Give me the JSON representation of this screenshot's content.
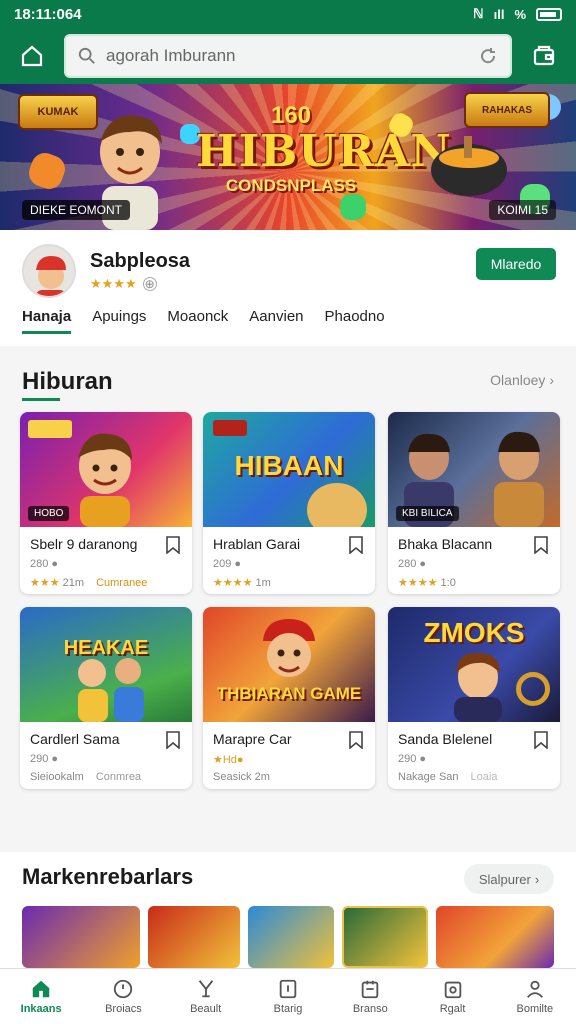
{
  "status_bar": {
    "time": "18:11:064",
    "signal": "ıll",
    "network": "%"
  },
  "search": {
    "value": "agorah Imburann"
  },
  "banner": {
    "number": "160",
    "title": "HIBURAN",
    "subtitle": "CONDSNPLASS",
    "logo_left": "KUMAK",
    "logo_right": "RAHAKAS",
    "caption_left": "DIEKE EOMONT",
    "caption_right": "KOIMI 15"
  },
  "profile": {
    "name": "Sabpleosa",
    "stars": "★★★★",
    "follow_label": "Mlaredo",
    "tabs": [
      "Hanaja",
      "Apuings",
      "Moaonck",
      "Aanvien",
      "Phaodno"
    ]
  },
  "section1": {
    "title": "Hiburan",
    "link": "Olanloey",
    "cards": [
      {
        "name": "Sbelr 9 daranong",
        "meta1": "280 ●",
        "stars": "★★★",
        "meta2": "21m",
        "right": "Cumranee",
        "tag": "HOBO",
        "thumb_label": ""
      },
      {
        "name": "Hrablan Garai",
        "meta1": "209 ●",
        "stars": "★★★★",
        "meta2": "1m",
        "right": "",
        "tag": "",
        "thumb_label": "HIBAAN"
      },
      {
        "name": "Bhaka Blacann",
        "meta1": "280 ●",
        "stars": "★★★★",
        "meta2": "1:0",
        "right": "",
        "tag": "KBI BILICA",
        "thumb_label": ""
      },
      {
        "name": "Cardlerl Sama",
        "meta1": "290 ●",
        "stars": "",
        "meta2": "Sieiookalm",
        "right": "Conmrea",
        "tag": "",
        "thumb_label": "HEAKAE"
      },
      {
        "name": "Marapre Car",
        "meta1": "★Hd●",
        "stars": "",
        "meta2": "Seasick 2m",
        "right": "",
        "tag": "",
        "thumb_label": "THBIARAN GAME"
      },
      {
        "name": "Sanda Blelenel",
        "meta1": "290 ●",
        "stars": "",
        "meta2": "Nakage San",
        "right": "Loaia",
        "tag": "",
        "thumb_label": "ZMOKS"
      }
    ]
  },
  "section2": {
    "title": "Markenrebarlars",
    "button": "Slalpurer"
  },
  "bottom_nav": [
    {
      "label": "Inkaans",
      "icon": "home-icon"
    },
    {
      "label": "Broiacs",
      "icon": "clock-icon"
    },
    {
      "label": "Beault",
      "icon": "trophy-icon"
    },
    {
      "label": "Btarig",
      "icon": "info-icon"
    },
    {
      "label": "Branso",
      "icon": "gamepad-icon"
    },
    {
      "label": "Rgalt",
      "icon": "gift-icon"
    },
    {
      "label": "Bomilte",
      "icon": "user-icon"
    }
  ],
  "colors": {
    "brand": "#0b7a4a",
    "accent": "#0f8a54",
    "gold": "#ffd93a"
  }
}
